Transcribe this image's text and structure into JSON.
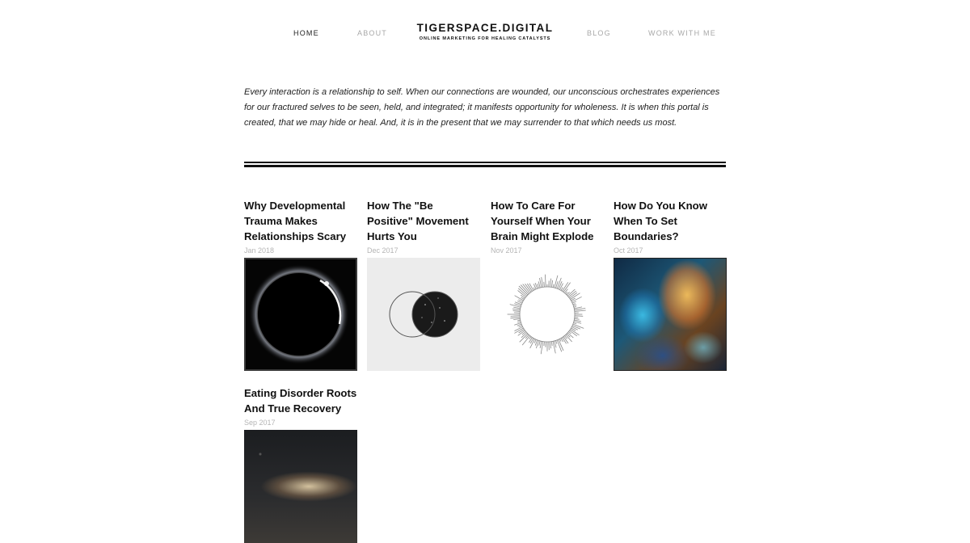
{
  "nav": {
    "home": "HOME",
    "about": "ABOUT",
    "blog": "BLOG",
    "work": "WORK WITH ME"
  },
  "brand": {
    "title": "TIGERSPACE.DIGITAL",
    "tagline": "ONLINE MARKETING FOR HEALING CATALYSTS"
  },
  "intro": "Every interaction is a relationship to self. When our connections are wounded, our unconscious orchestrates experiences for our fractured selves to be seen, held, and integrated; it manifests opportunity for wholeness. It is when this portal is created, that we may hide or heal. And, it is in the present that we may surrender to that which needs us most.",
  "posts": [
    {
      "title": "Why Developmental Trauma Makes Relationships Scary",
      "date": "Jan 2018",
      "image": "eclipse"
    },
    {
      "title": "How The \"Be Positive\" Movement Hurts You",
      "date": "Dec 2017",
      "image": "venn-circles"
    },
    {
      "title": "How To Care For Yourself When Your Brain Might Explode",
      "date": "Nov 2017",
      "image": "sound-ring"
    },
    {
      "title": "How Do You Know When To Set Boundaries?",
      "date": "Oct 2017",
      "image": "nebula"
    },
    {
      "title": "Eating Disorder Roots And True Recovery",
      "date": "Sep 2017",
      "image": "galaxy"
    }
  ],
  "colors": {
    "text": "#111111",
    "nav_muted": "#a8a8a8",
    "date": "#b5b5b5",
    "background": "#ffffff"
  }
}
